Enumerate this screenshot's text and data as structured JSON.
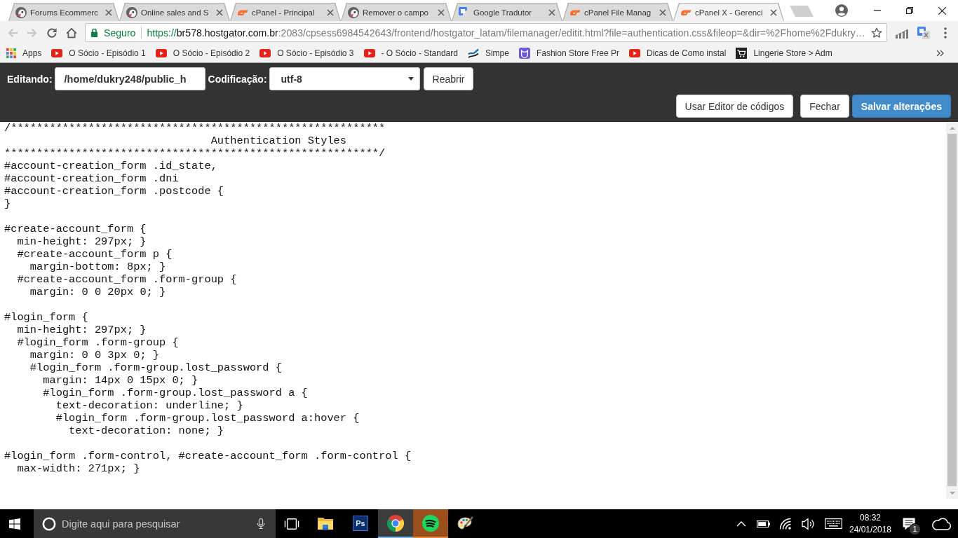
{
  "browser": {
    "tabs": [
      {
        "kind": "prestashop",
        "title": "Forums Ecommerc",
        "selected": false
      },
      {
        "kind": "prestashop",
        "title": "Online sales and S",
        "selected": false
      },
      {
        "kind": "cpanel",
        "title": "cPanel - Principal",
        "selected": false
      },
      {
        "kind": "prestashop",
        "title": "Remover o campo",
        "selected": false
      },
      {
        "kind": "translate",
        "title": "Google Tradutor",
        "selected": false
      },
      {
        "kind": "cpanel",
        "title": "cPanel File Manag",
        "selected": false
      },
      {
        "kind": "cpanel",
        "title": "cPanel X - Gerenci",
        "selected": true
      }
    ],
    "nav_buttons": [
      {
        "kind": "back",
        "disabled": true
      },
      {
        "kind": "forward",
        "disabled": true
      },
      {
        "kind": "reload",
        "disabled": false
      },
      {
        "kind": "home",
        "disabled": false
      }
    ],
    "address": {
      "security": "Seguro",
      "scheme": "https://",
      "host": "br578.hostgator.com.br",
      "rest": ":2083/cpsess6984542643/frontend/hostgator_latam/filemanager/editit.html?file=authentication.css&fileop=&dir=%2Fhome%2Fdukry…"
    },
    "bookmarks": [
      {
        "kind": "apps",
        "label": "Apps"
      },
      {
        "kind": "youtube",
        "label": "O Sócio - Episódio 1"
      },
      {
        "kind": "youtube",
        "label": "O Sócio - Episódio 2"
      },
      {
        "kind": "youtube",
        "label": "O Sócio - Episódio 3"
      },
      {
        "kind": "youtube",
        "label": "- O Sócio - Standard"
      },
      {
        "kind": "wave",
        "label": "Simpe"
      },
      {
        "kind": "cat",
        "label": "Fashion Store Free Pr"
      },
      {
        "kind": "youtube",
        "label": "Dicas de Como instal"
      },
      {
        "kind": "cart",
        "label": "Lingerie Store > Adm"
      }
    ]
  },
  "editor": {
    "path_label": "Editando:",
    "path": "/home/dukry248/public_h",
    "encoding_label": "Codificação:",
    "encoding": "utf-8",
    "reopen_button": "Reabrir",
    "actions": [
      {
        "label": "Usar Editor de códigos",
        "kind": "default"
      },
      {
        "label": "Fechar",
        "kind": "default"
      },
      {
        "label": "Salvar alterações",
        "kind": "primary"
      }
    ],
    "code_blocks": [
      [
        "/**********************************************************",
        "                                Authentication Styles",
        "**********************************************************/",
        "#account-creation_form .id_state,",
        "#account-creation_form .dni",
        "#account-creation_form .postcode {",
        "}"
      ],
      [
        "#create-account_form {",
        "  min-height: 297px; }",
        "  #create-account_form p {",
        "    margin-bottom: 8px; }",
        "  #create-account_form .form-group {",
        "    margin: 0 0 20px 0; }"
      ],
      [
        "#login_form {",
        "  min-height: 297px; }",
        "  #login_form .form-group {",
        "    margin: 0 0 3px 0; }",
        "    #login_form .form-group.lost_password {",
        "      margin: 14px 0 15px 0; }",
        "      #login_form .form-group.lost_password a {",
        "        text-decoration: underline; }",
        "        #login_form .form-group.lost_password a:hover {",
        "          text-decoration: none; }"
      ],
      [
        "#login_form .form-control, #create-account_form .form-control {",
        "  max-width: 271px; }"
      ]
    ]
  },
  "taskbar": {
    "search": {
      "placeholder": "Digite aqui para pesquisar"
    },
    "apps": [
      {
        "kind": "explorer",
        "selected": false,
        "flashing": false
      },
      {
        "kind": "photoshop",
        "label": "Ps",
        "selected": false,
        "flashing": false
      },
      {
        "kind": "chrome",
        "selected": true,
        "flashing": false
      },
      {
        "kind": "spotify",
        "selected": false,
        "flashing": true
      },
      {
        "kind": "paint",
        "selected": false,
        "flashing": false
      }
    ],
    "clock": {
      "time": "08:32",
      "date": "24/01/2018"
    },
    "notification_count": "1"
  }
}
